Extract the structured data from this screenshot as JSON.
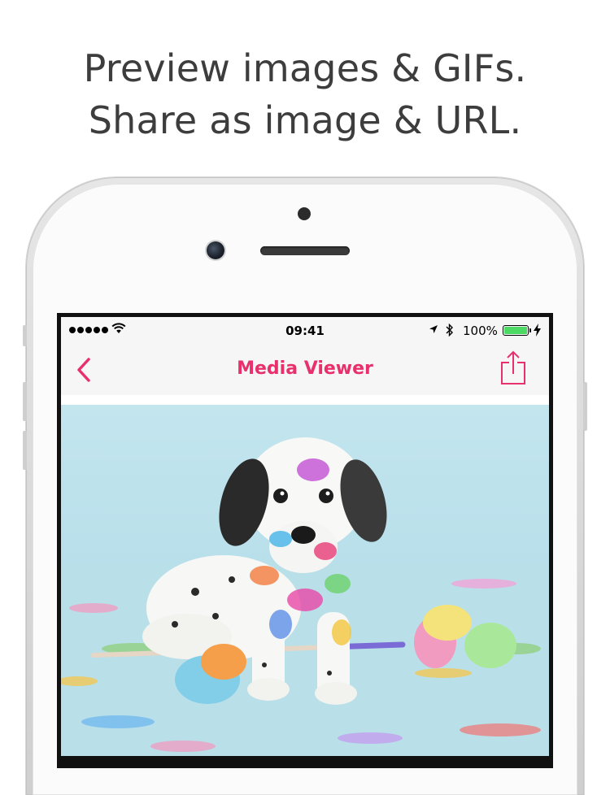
{
  "headline": {
    "line1": "Preview images & GIFs.",
    "line2": "Share as image & URL."
  },
  "status_bar": {
    "signal_dots": 5,
    "time": "09:41",
    "battery_percent": "100%",
    "battery_level": 1.0
  },
  "nav_bar": {
    "title": "Media Viewer",
    "back_icon": "chevron-left-icon",
    "share_icon": "share-icon"
  },
  "media": {
    "description_icon": "dalmatian-puppy-photo"
  },
  "colors": {
    "accent": "#e8306d",
    "battery": "#4cd964",
    "nav_background": "#f6f6f6",
    "photo_backdrop": "#bfe3ec"
  }
}
